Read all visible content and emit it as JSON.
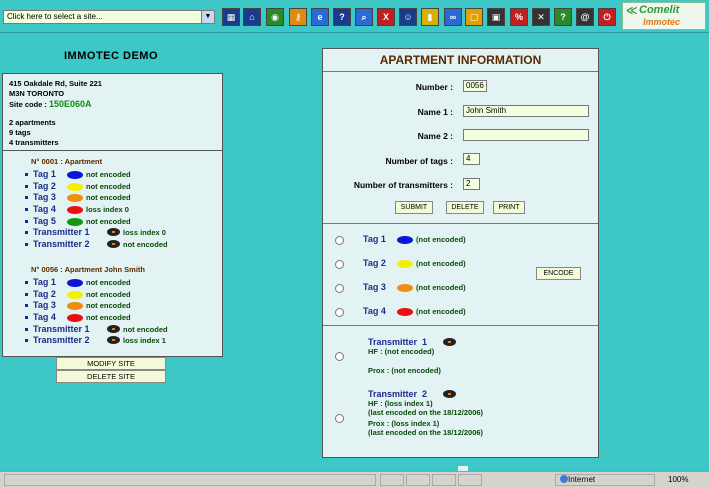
{
  "toolbar": {
    "site_select": "Click here to select a site...",
    "icons": [
      {
        "name": "building-icon",
        "glyph": "▦",
        "color": "#1a3a8a"
      },
      {
        "name": "home-icon",
        "glyph": "⌂",
        "color": "#1a3a8a"
      },
      {
        "name": "database-icon",
        "glyph": "◉",
        "color": "#2a8a2a"
      },
      {
        "name": "key-icon",
        "glyph": "⚷",
        "color": "#e08a12"
      },
      {
        "name": "ie-icon",
        "glyph": "e",
        "color": "#2a6ad5"
      },
      {
        "name": "help-icon",
        "glyph": "?",
        "color": "#1a3a8a"
      },
      {
        "name": "search-icon",
        "glyph": "⌕",
        "color": "#2a6ad5"
      },
      {
        "name": "excel-icon",
        "glyph": "X",
        "color": "#c02020"
      },
      {
        "name": "users-icon",
        "glyph": "☺",
        "color": "#1a3a8a"
      },
      {
        "name": "card-icon",
        "glyph": "▮",
        "color": "#d8b000"
      },
      {
        "name": "link-icon",
        "glyph": "∞",
        "color": "#2a6ad5"
      },
      {
        "name": "frame-icon",
        "glyph": "▢",
        "color": "#e0a000"
      },
      {
        "name": "save-icon",
        "glyph": "▣",
        "color": "#333333"
      },
      {
        "name": "percent-icon",
        "glyph": "%",
        "color": "#c02020"
      },
      {
        "name": "tools-icon",
        "glyph": "✕",
        "color": "#333333"
      },
      {
        "name": "help-book-icon",
        "glyph": "?",
        "color": "#2a8a2a"
      },
      {
        "name": "at-icon",
        "glyph": "@",
        "color": "#333333"
      },
      {
        "name": "exit-icon",
        "glyph": "⏻",
        "color": "#c02020"
      }
    ],
    "icon_labels": {
      "database": "Base",
      "excel": "Excel",
      "save": "Save",
      "percent": "Debug",
      "help_book": "Help"
    },
    "logo_brand": "Comelit",
    "logo_product": "Immotec"
  },
  "site": {
    "title": "IMMOTEC DEMO",
    "address1": "415 Oakdale Rd, Suite 221",
    "address2": "M3N TORONTO",
    "code_label": "Site code : ",
    "code_value": "150E060A",
    "apartments": "2 apartments",
    "tags": "9 tags",
    "transmitters": "4 transmitters"
  },
  "apartments": [
    {
      "header": "N° 0001 : Apartment",
      "items": [
        {
          "label": "Tag 1",
          "color": "#0a16d8",
          "status": "not encoded",
          "type": "tag"
        },
        {
          "label": "Tag 2",
          "color": "#f4f000",
          "status": "not encoded",
          "type": "tag"
        },
        {
          "label": "Tag 3",
          "color": "#f08c10",
          "status": "not encoded",
          "type": "tag"
        },
        {
          "label": "Tag 4",
          "color": "#e81010",
          "status": "loss index 0",
          "type": "tag"
        },
        {
          "label": "Tag 5",
          "color": "#0e9a0e",
          "status": "not encoded",
          "type": "tag"
        },
        {
          "label": "Transmitter 1",
          "status": "loss index 0",
          "type": "tr"
        },
        {
          "label": "Transmitter 2",
          "status": "not encoded",
          "type": "tr"
        }
      ]
    },
    {
      "header": "N° 0056 : Apartment John Smith",
      "items": [
        {
          "label": "Tag 1",
          "color": "#0a16d8",
          "status": "not encoded",
          "type": "tag"
        },
        {
          "label": "Tag 2",
          "color": "#f4f000",
          "status": "not encoded",
          "type": "tag"
        },
        {
          "label": "Tag 3",
          "color": "#f08c10",
          "status": "not encoded",
          "type": "tag"
        },
        {
          "label": "Tag 4",
          "color": "#e81010",
          "status": "not encoded",
          "type": "tag"
        },
        {
          "label": "Transmitter 1",
          "status": "not encoded",
          "type": "tr"
        },
        {
          "label": "Transmitter 2",
          "status": "loss index 1",
          "type": "tr"
        }
      ]
    }
  ],
  "site_buttons": {
    "modify": "MODIFY SITE",
    "delete": "DELETE SITE"
  },
  "apt_info": {
    "title": "APARTMENT INFORMATION",
    "number_label": "Number :",
    "number_value": "0056",
    "name1_label": "Name 1 :",
    "name1_value": "John Smith",
    "name2_label": "Name 2 :",
    "name2_value": "",
    "tags_label": "Number of tags :",
    "tags_value": "4",
    "tr_label": "Number of transmitters :",
    "tr_value": "2",
    "submit": "SUBMIT",
    "delete": "DELETE",
    "print": "PRINT",
    "encode": "ENCODE"
  },
  "tag_rows": [
    {
      "label": "Tag 1",
      "color": "#0a16d8",
      "status": "(not encoded)"
    },
    {
      "label": "Tag 2",
      "color": "#f4f000",
      "status": "(not encoded)"
    },
    {
      "label": "Tag 3",
      "color": "#f08c10",
      "status": "(not encoded)"
    },
    {
      "label": "Tag 4",
      "color": "#e81010",
      "status": "(not encoded)"
    }
  ],
  "transmitters": [
    {
      "label": "Transmitter  1",
      "hf": "HF : (not encoded)",
      "hf2": "",
      "prox": "Prox : (not encoded)",
      "prox2": ""
    },
    {
      "label": "Transmitter  2",
      "hf": "HF : (loss index 1)",
      "hf2": "(last encoded on the 18/12/2006)",
      "prox": "Prox : (loss index 1)",
      "prox2": "(last encoded on the 18/12/2006)"
    }
  ],
  "statusbar": {
    "zone": "Internet",
    "zoom": "100%"
  }
}
